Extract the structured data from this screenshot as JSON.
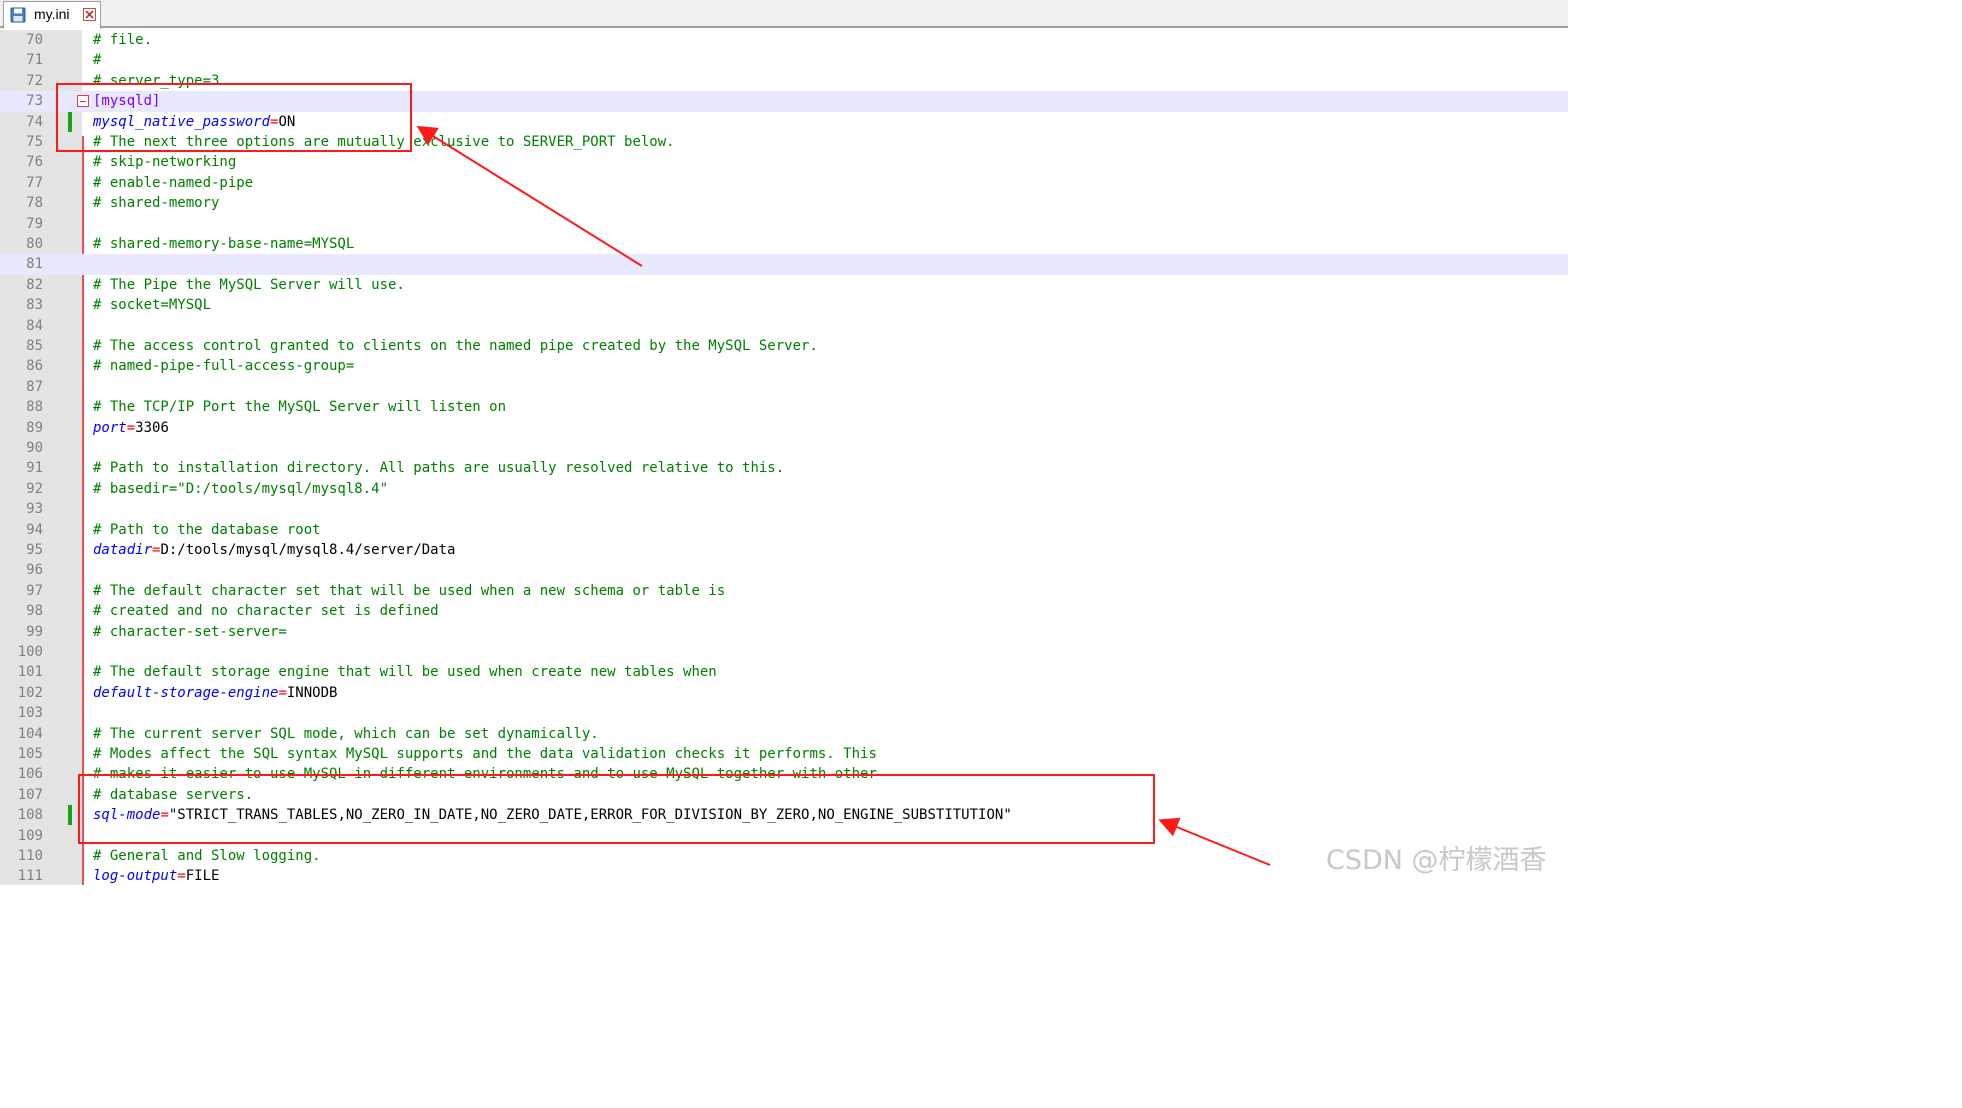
{
  "tab": {
    "filename": "my.ini",
    "icon": "floppy-save-icon",
    "close_icon": "close-icon"
  },
  "colors": {
    "comment": "#008000",
    "section": "#8000ff",
    "key": "#0000ff",
    "operator": "#ff0000",
    "annotation": "#ff1a1a",
    "current_line": "#e8e8ff"
  },
  "editor": {
    "lines": [
      {
        "num": "70",
        "type": "comment",
        "text": "# file."
      },
      {
        "num": "71",
        "type": "comment",
        "text": "#"
      },
      {
        "num": "72",
        "type": "comment",
        "text": "# server_type=3"
      },
      {
        "num": "73",
        "type": "section",
        "text": "[mysqld]",
        "fold": true
      },
      {
        "num": "74",
        "type": "kv",
        "key": "mysql_native_password",
        "value": "ON",
        "changed": true
      },
      {
        "num": "75",
        "type": "comment",
        "text": "# The next three options are mutually exclusive to SERVER_PORT below."
      },
      {
        "num": "76",
        "type": "comment",
        "text": "# skip-networking"
      },
      {
        "num": "77",
        "type": "comment",
        "text": "# enable-named-pipe"
      },
      {
        "num": "78",
        "type": "comment",
        "text": "# shared-memory"
      },
      {
        "num": "79",
        "type": "blank",
        "text": ""
      },
      {
        "num": "80",
        "type": "comment",
        "text": "# shared-memory-base-name=MYSQL"
      },
      {
        "num": "81",
        "type": "blank",
        "text": "",
        "current": true
      },
      {
        "num": "82",
        "type": "comment",
        "text": "# The Pipe the MySQL Server will use."
      },
      {
        "num": "83",
        "type": "comment",
        "text": "# socket=MYSQL"
      },
      {
        "num": "84",
        "type": "blank",
        "text": ""
      },
      {
        "num": "85",
        "type": "comment",
        "text": "# The access control granted to clients on the named pipe created by the MySQL Server."
      },
      {
        "num": "86",
        "type": "comment",
        "text": "# named-pipe-full-access-group="
      },
      {
        "num": "87",
        "type": "blank",
        "text": ""
      },
      {
        "num": "88",
        "type": "comment",
        "text": "# The TCP/IP Port the MySQL Server will listen on"
      },
      {
        "num": "89",
        "type": "kv",
        "key": "port",
        "value": "3306"
      },
      {
        "num": "90",
        "type": "blank",
        "text": ""
      },
      {
        "num": "91",
        "type": "comment",
        "text": "# Path to installation directory. All paths are usually resolved relative to this."
      },
      {
        "num": "92",
        "type": "comment",
        "text": "# basedir=\"D:/tools/mysql/mysql8.4\""
      },
      {
        "num": "93",
        "type": "blank",
        "text": ""
      },
      {
        "num": "94",
        "type": "comment",
        "text": "# Path to the database root"
      },
      {
        "num": "95",
        "type": "kv",
        "key": "datadir",
        "value": "D:/tools/mysql/mysql8.4/server/Data"
      },
      {
        "num": "96",
        "type": "blank",
        "text": ""
      },
      {
        "num": "97",
        "type": "comment",
        "text": "# The default character set that will be used when a new schema or table is"
      },
      {
        "num": "98",
        "type": "comment",
        "text": "# created and no character set is defined"
      },
      {
        "num": "99",
        "type": "comment",
        "text": "# character-set-server="
      },
      {
        "num": "100",
        "type": "blank",
        "text": ""
      },
      {
        "num": "101",
        "type": "comment",
        "text": "# The default storage engine that will be used when create new tables when"
      },
      {
        "num": "102",
        "type": "kv",
        "key": "default-storage-engine",
        "value": "INNODB"
      },
      {
        "num": "103",
        "type": "blank",
        "text": ""
      },
      {
        "num": "104",
        "type": "comment",
        "text": "# The current server SQL mode, which can be set dynamically."
      },
      {
        "num": "105",
        "type": "comment",
        "text": "# Modes affect the SQL syntax MySQL supports and the data validation checks it performs. This"
      },
      {
        "num": "106",
        "type": "comment",
        "text": "# makes it easier to use MySQL in different environments and to use MySQL together with other"
      },
      {
        "num": "107",
        "type": "comment",
        "text": "# database servers."
      },
      {
        "num": "108",
        "type": "kv",
        "key": "sql-mode",
        "value": "\"STRICT_TRANS_TABLES,NO_ZERO_IN_DATE,NO_ZERO_DATE,ERROR_FOR_DIVISION_BY_ZERO,NO_ENGINE_SUBSTITUTION\"",
        "changed": true
      },
      {
        "num": "109",
        "type": "blank",
        "text": ""
      },
      {
        "num": "110",
        "type": "comment",
        "text": "# General and Slow logging."
      },
      {
        "num": "111",
        "type": "kv",
        "key": "log-output",
        "value": "FILE"
      }
    ]
  },
  "watermark": "CSDN @柠檬酒香"
}
